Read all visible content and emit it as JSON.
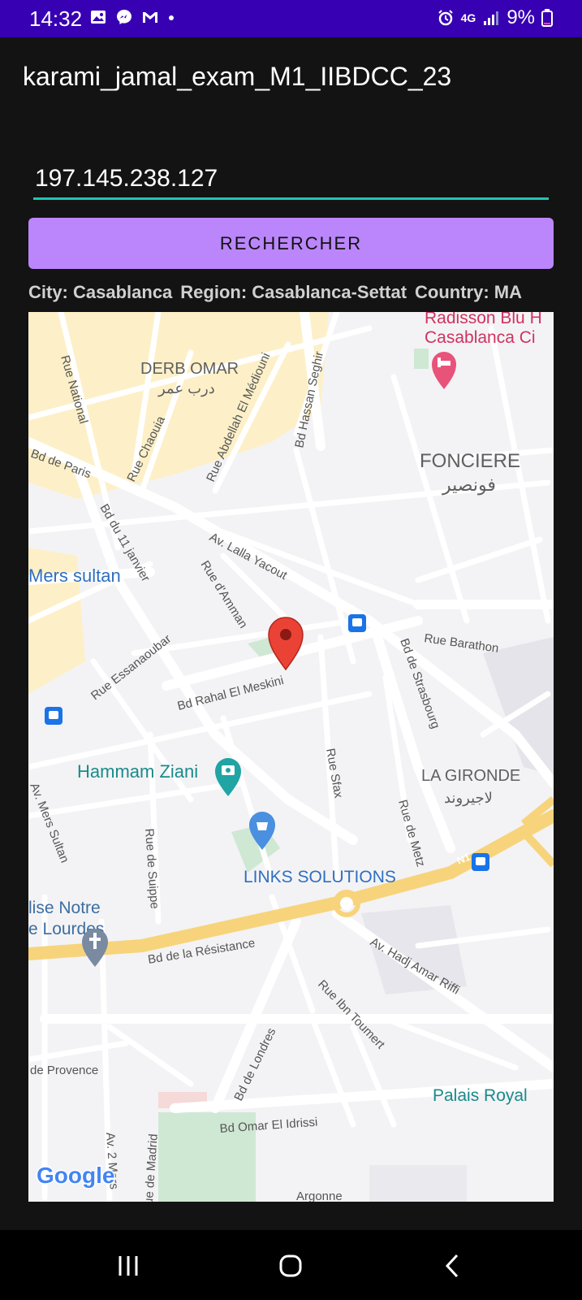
{
  "status_bar": {
    "time": "14:32",
    "battery": "9%",
    "network": "4G"
  },
  "app": {
    "title": "karami_jamal_exam_M1_IIBDCC_23"
  },
  "form": {
    "ip_value": "197.145.238.127",
    "search_label": "RECHERCHER"
  },
  "result": {
    "city": "City: Casablanca",
    "region": "Region: Casablanca-Settat",
    "country": "Country: MA"
  },
  "map": {
    "labels": {
      "radisson": "Radisson Blu H",
      "radisson2": "Casablanca Ci",
      "derb_omar": "DERB OMAR",
      "derb_omar_ar": "درب عمر",
      "fonciere": "FONCIERE",
      "fonciere_ar": "فونصير",
      "mers_sultan": "Mers sultan",
      "la_gironde": "LA GIRONDE",
      "la_gironde_ar": "لاجيروند",
      "hammam": "Hammam Ziani",
      "links": "LINKS SOLUTIONS",
      "eglise1": "lise Notre",
      "eglise2": "e Lourdes",
      "palais": "Palais Royal",
      "google": "Google",
      "rue_national": "Rue National",
      "rue_chaouia": "Rue Chaouia",
      "rue_abdellah": "Rue Abdellah El Médiouni",
      "bd_hassan": "Bd Hassan Seghir",
      "bd_paris": "Bd de Paris",
      "bd_11": "Bd du 11 janvier",
      "lalla_yacout": "Av. Lalla Yacout",
      "rue_amman": "Rue d'Amman",
      "rue_barathon": "Rue Barathon",
      "bd_strasbourg": "Bd de Strasbourg",
      "rue_essanaoubar": "Rue Essanaoubar",
      "bd_rahal": "Bd Rahal El Meskini",
      "rue_sfax": "Rue Sfax",
      "rue_metz": "Rue de Metz",
      "av_mers_sultan": "Av. Mers Sultan",
      "rue_suippe": "Rue de Suippe",
      "bd_resistance": "Bd de la Résistance",
      "hadj_amar": "Av. Hadj Amar Riffi",
      "ibn_toumert": "Rue Ibn Toumert",
      "provence": "de Provence",
      "bd_londres": "Bd de Londres",
      "omar_idrissi": "Bd Omar El Idrissi",
      "av_2_mars": "Av. 2 Mars",
      "rue_madrid": "Rue de Madrid",
      "argonne": "Argonne",
      "n1": "N1"
    }
  }
}
